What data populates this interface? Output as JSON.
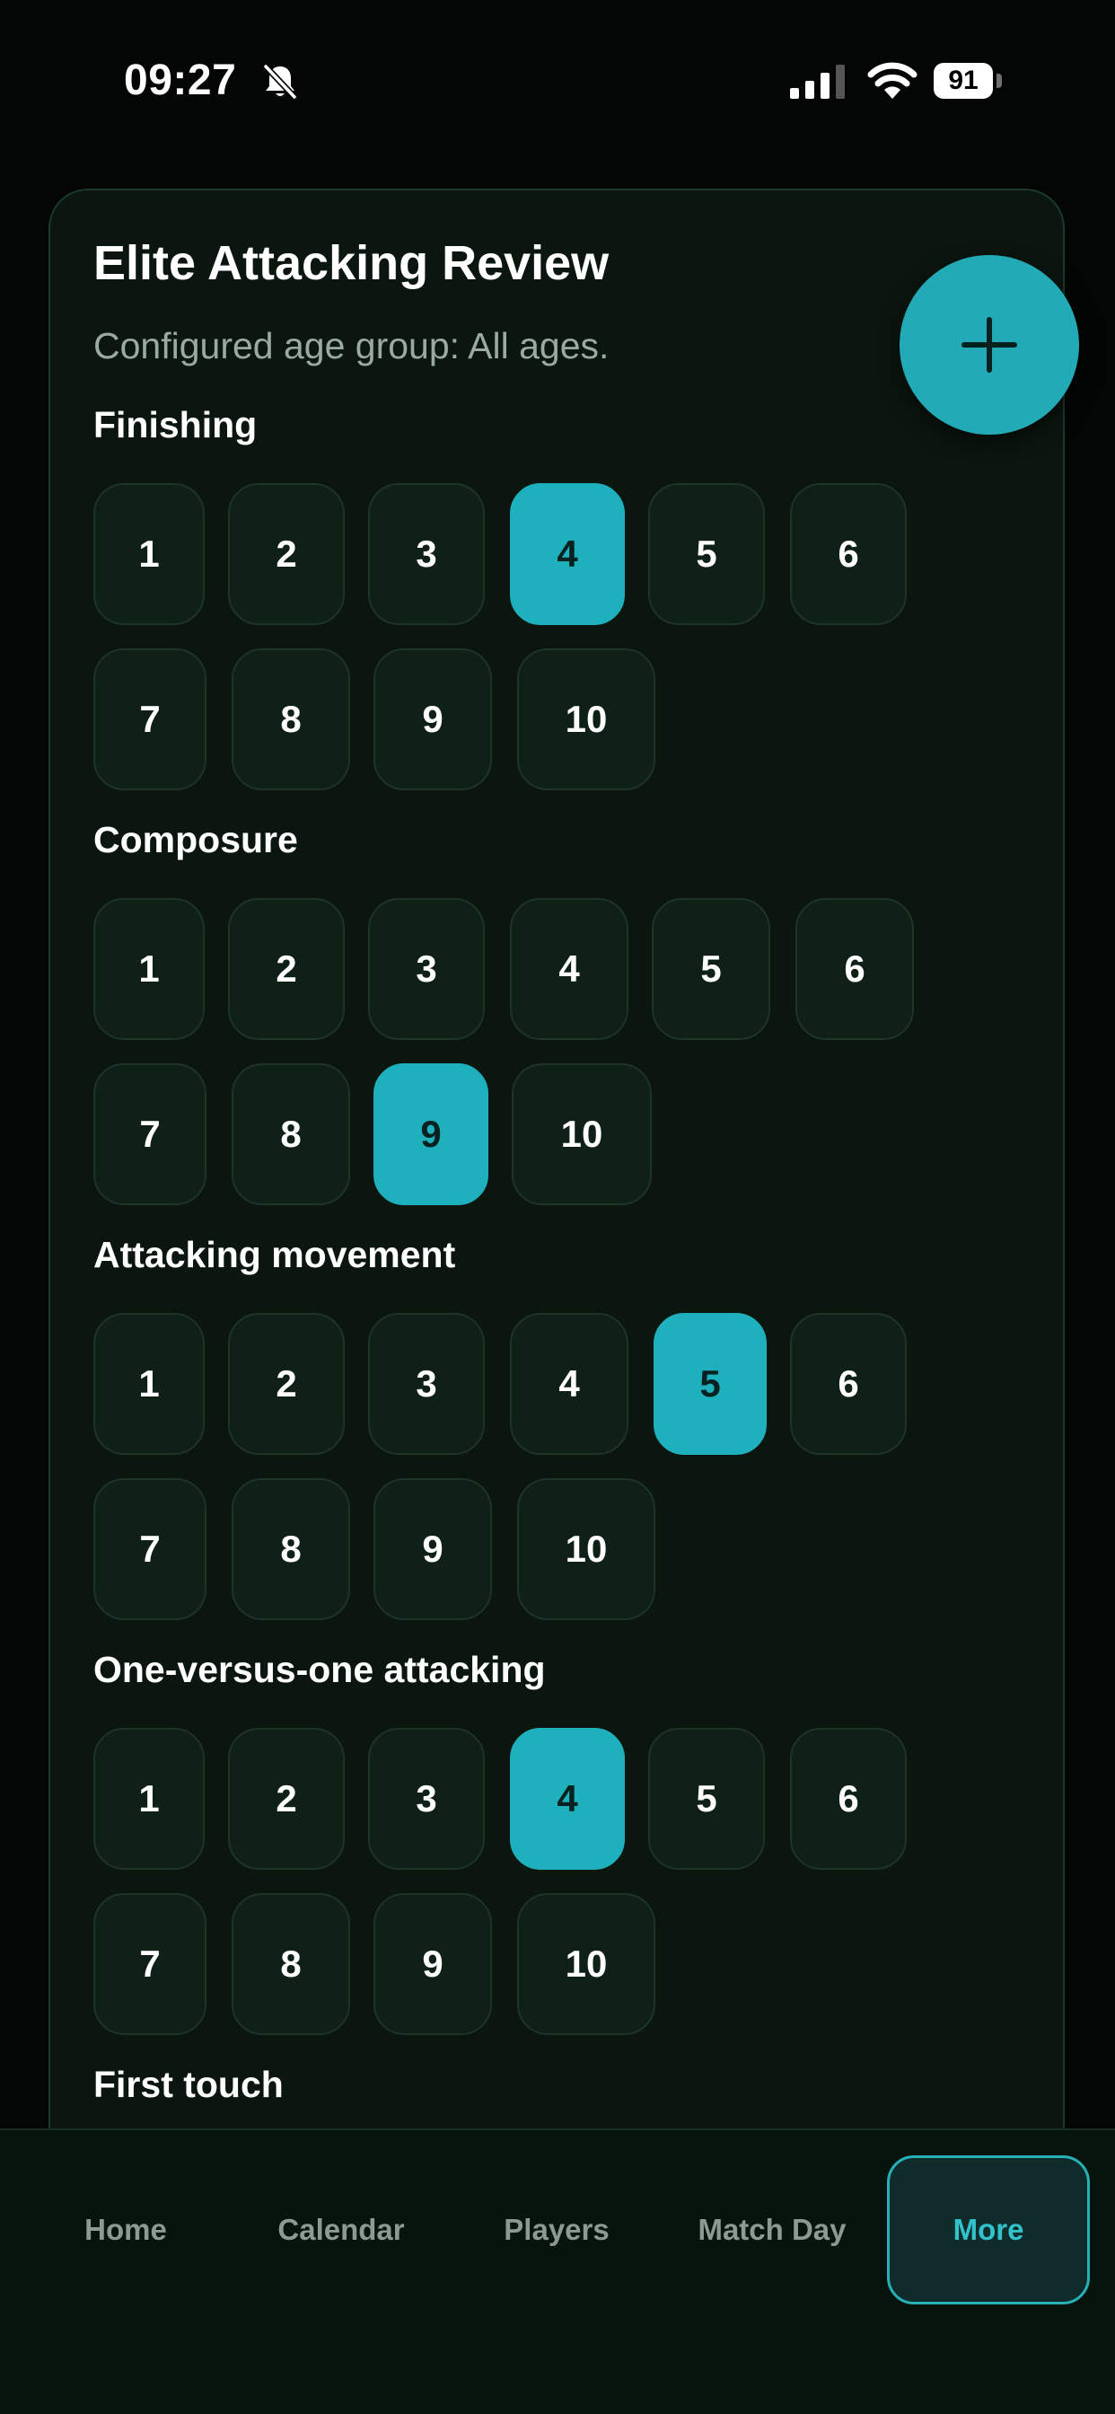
{
  "status_bar": {
    "time": "09:27",
    "battery": "91"
  },
  "card": {
    "title": "Elite Attacking Review",
    "subtitle": "Configured age group: All ages."
  },
  "categories": [
    {
      "label": "Finishing",
      "selected": 4,
      "options": [
        "1",
        "2",
        "3",
        "4",
        "5",
        "6",
        "7",
        "8",
        "9",
        "10"
      ]
    },
    {
      "label": "Composure",
      "selected": 9,
      "options": [
        "1",
        "2",
        "3",
        "4",
        "5",
        "6",
        "7",
        "8",
        "9",
        "10"
      ]
    },
    {
      "label": "Attacking movement",
      "selected": 5,
      "options": [
        "1",
        "2",
        "3",
        "4",
        "5",
        "6",
        "7",
        "8",
        "9",
        "10"
      ]
    },
    {
      "label": "One-versus-one attacking",
      "selected": 4,
      "options": [
        "1",
        "2",
        "3",
        "4",
        "5",
        "6",
        "7",
        "8",
        "9",
        "10"
      ]
    },
    {
      "label": "First touch"
    }
  ],
  "fab": {
    "icon": "plus-icon"
  },
  "nav": {
    "items": [
      {
        "label": "Home"
      },
      {
        "label": "Calendar"
      },
      {
        "label": "Players"
      },
      {
        "label": "Match Day"
      },
      {
        "label": "More",
        "active": true
      }
    ]
  },
  "colors": {
    "accent": "#1fb0bd",
    "background": "#030604",
    "card": "#0b160f",
    "button": "#0f2016"
  }
}
